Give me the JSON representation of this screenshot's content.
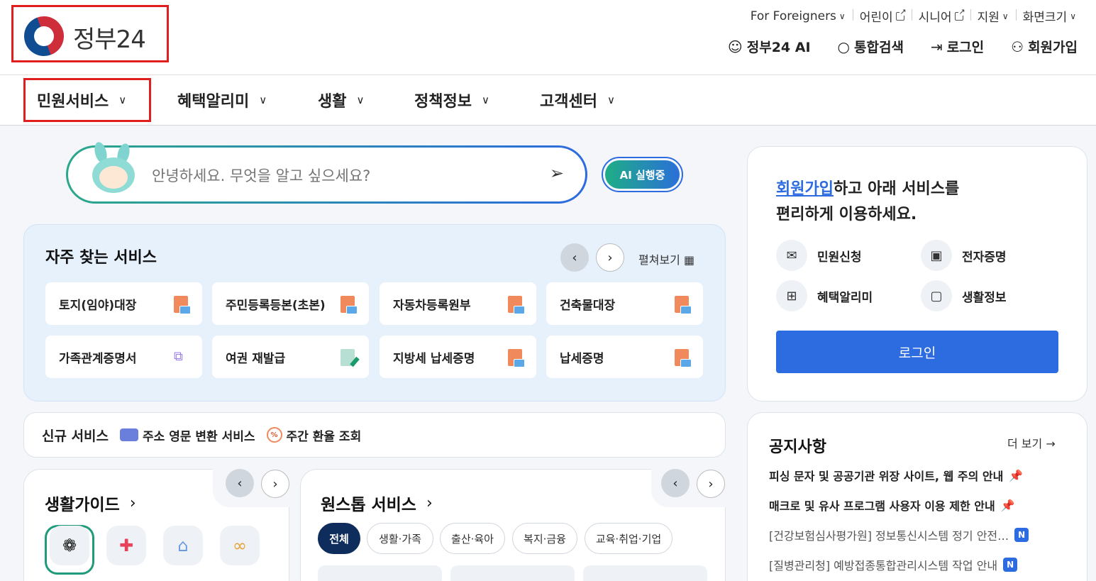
{
  "header": {
    "logo_text": "정부24",
    "util_links": [
      {
        "label": "For Foreigners"
      },
      {
        "label": "어린이"
      },
      {
        "label": "시니어"
      },
      {
        "label": "지원"
      },
      {
        "label": "화면크기"
      }
    ],
    "main_links": [
      {
        "label": "정부24 AI",
        "icon": "robot-icon"
      },
      {
        "label": "통합검색",
        "icon": "search-icon"
      },
      {
        "label": "로그인",
        "icon": "login-icon"
      },
      {
        "label": "회원가입",
        "icon": "user-add-icon"
      }
    ]
  },
  "gnb": [
    {
      "label": "민원서비스"
    },
    {
      "label": "혜택알리미"
    },
    {
      "label": "생활"
    },
    {
      "label": "정책정보"
    },
    {
      "label": "고객센터"
    }
  ],
  "search": {
    "placeholder": "안녕하세요. 무엇을 알고 싶으세요?",
    "ai_button": "AI 실행중"
  },
  "frequent": {
    "title": "자주 찾는 서비스",
    "expand_label": "펼쳐보기",
    "items": [
      {
        "label": "토지(임야)대장",
        "icon": "pdf-icon"
      },
      {
        "label": "주민등록등본(초본)",
        "icon": "pdf-icon"
      },
      {
        "label": "자동차등록원부",
        "icon": "pdf-icon"
      },
      {
        "label": "건축물대장",
        "icon": "pdf-icon"
      },
      {
        "label": "가족관계증명서",
        "icon": "external-link-icon"
      },
      {
        "label": "여권 재발급",
        "icon": "edit-icon"
      },
      {
        "label": "지방세 납세증명",
        "icon": "pdf-icon"
      },
      {
        "label": "납세증명",
        "icon": "pdf-icon"
      }
    ]
  },
  "new_services": {
    "label": "신규 서비스",
    "items": [
      {
        "label": "주소 영문 변환 서비스",
        "icon": "folder-icon"
      },
      {
        "label": "주간 환율 조회",
        "icon": "exchange-rate-icon"
      }
    ]
  },
  "life_guide": {
    "title": "생활가이드",
    "icons": [
      "baby-icon",
      "health-icon",
      "person-icon",
      "rings-icon"
    ]
  },
  "onestop": {
    "title": "원스톱 서비스",
    "chips": [
      "전체",
      "생활·가족",
      "출산·육아",
      "복지·금융",
      "교육·취업·기업"
    ]
  },
  "login_card": {
    "msg_link": "회원가입",
    "msg_rest": "하고 아래 서비스를",
    "msg_line2": "편리하게 이용하세요.",
    "benefits": [
      {
        "label": "민원신청",
        "icon": "mail-icon"
      },
      {
        "label": "전자증명",
        "icon": "id-card-icon"
      },
      {
        "label": "혜택알리미",
        "icon": "gift-icon"
      },
      {
        "label": "생활정보",
        "icon": "bookmark-icon"
      }
    ],
    "login_button": "로그인"
  },
  "notice": {
    "title": "공지사항",
    "more": "더 보기",
    "items": [
      {
        "text": "피싱 문자 및 공공기관 위장 사이트, 웹 주의 안내",
        "pinned": true
      },
      {
        "text": "매크로 및 유사 프로그램 사용자 이용 제한 안내",
        "pinned": true
      },
      {
        "text": "[건강보험심사평가원] 정보통신시스템 정기 안전…",
        "badge": "N"
      },
      {
        "text": "[질병관리청] 예방접종통합관리시스템 작업 안내",
        "badge": "N"
      }
    ]
  },
  "colors": {
    "accent": "#2d6be0",
    "highlight_border": "#e01e1e",
    "navy": "#0f2d5c"
  }
}
